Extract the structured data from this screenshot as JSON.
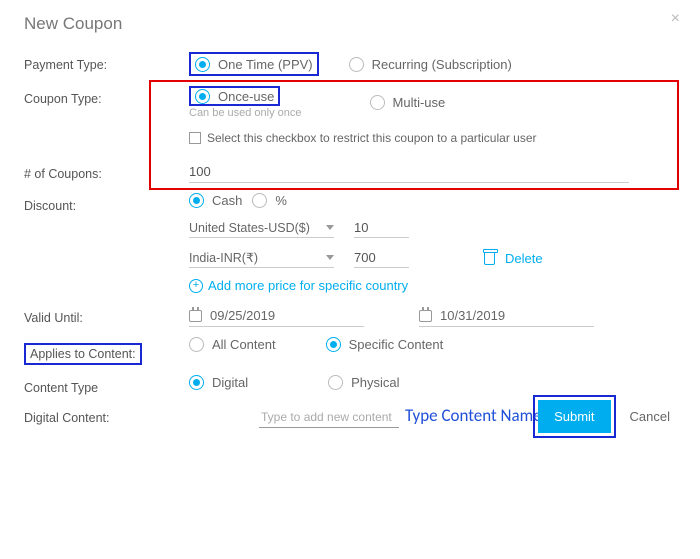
{
  "title": "New Coupon",
  "labels": {
    "payment_type": "Payment Type:",
    "coupon_type": "Coupon Type:",
    "num_coupons": "# of Coupons:",
    "discount": "Discount:",
    "valid_until": "Valid Until:",
    "applies_to": "Applies to Content:",
    "content_type": "Content Type",
    "digital_content": "Digital Content:"
  },
  "payment": {
    "one_time": "One Time (PPV)",
    "recurring": "Recurring (Subscription)"
  },
  "coupon": {
    "once": "Once-use",
    "once_hint": "Can be used only once",
    "multi": "Multi-use",
    "restrict": "Select this checkbox to restrict this coupon to a particular user"
  },
  "num_coupons_value": "100",
  "discount": {
    "cash": "Cash",
    "percent": "%",
    "rows": [
      {
        "country": "United States-USD($)",
        "value": "10"
      },
      {
        "country": "India-INR(₹)",
        "value": "700"
      }
    ],
    "delete": "Delete",
    "add_more": "Add more price for specific country"
  },
  "dates": {
    "from": "09/25/2019",
    "to": "10/31/2019"
  },
  "applies": {
    "all": "All Content",
    "specific": "Specific Content"
  },
  "ctype": {
    "digital": "Digital",
    "physical": "Physical"
  },
  "digital_content_placeholder": "Type to add new content",
  "annotation": "Type Content Name to Search",
  "buttons": {
    "submit": "Submit",
    "cancel": "Cancel"
  }
}
